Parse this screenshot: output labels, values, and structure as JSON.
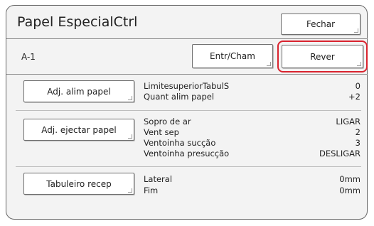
{
  "window": {
    "title": "Papel EspecialCtrl",
    "close_label": "Fechar"
  },
  "header": {
    "code": "A-1",
    "entry_button": "Entr/Cham",
    "review_button": "Rever"
  },
  "sections": {
    "paper_feed": {
      "button": "Adj. alim papel",
      "rows": [
        {
          "label": "LimitesuperiorTabulS",
          "value": "0"
        },
        {
          "label": "Quant alim papel",
          "value": "+2"
        }
      ]
    },
    "paper_eject": {
      "button": "Adj. ejectar papel",
      "rows": [
        {
          "label": "Sopro de ar",
          "value": "LIGAR"
        },
        {
          "label": "Vent sep",
          "value": "2"
        },
        {
          "label": "Ventoinha sucção",
          "value": "3"
        },
        {
          "label": "Ventoinha presucção",
          "value": "DESLIGAR"
        }
      ]
    },
    "receiving_tray": {
      "button": "Tabuleiro recep",
      "rows": [
        {
          "label": "Lateral",
          "value": "0mm"
        },
        {
          "label": "Fim",
          "value": "0mm"
        }
      ]
    }
  },
  "colors": {
    "highlight": "#d9232e",
    "background": "#f3f3f3"
  }
}
